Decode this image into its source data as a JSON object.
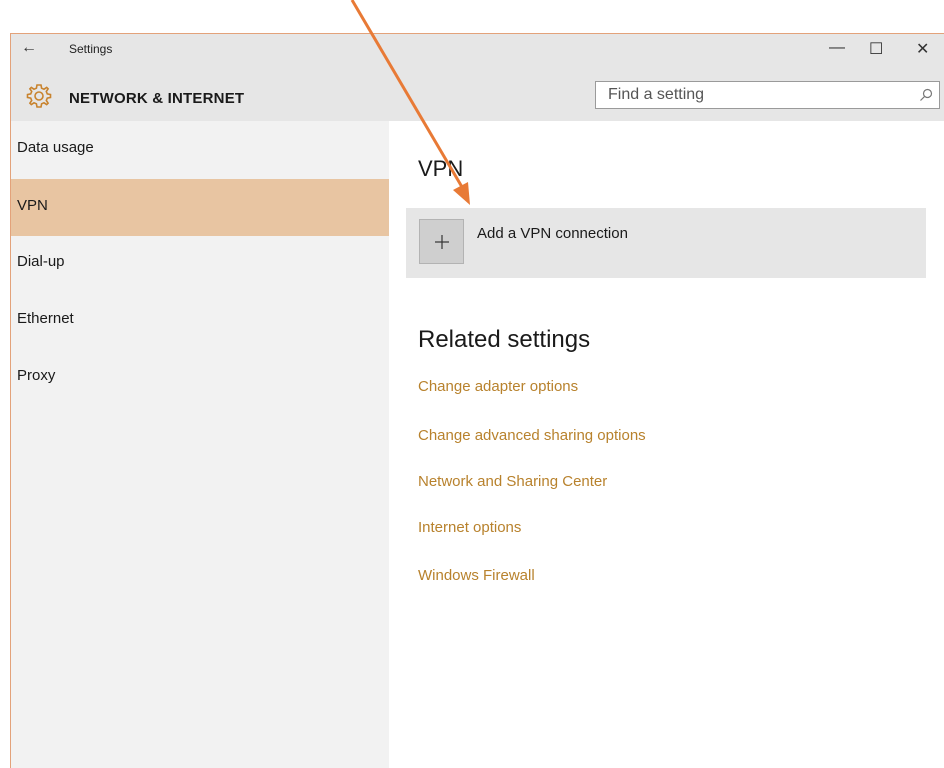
{
  "window": {
    "title": "Settings",
    "back_glyph": "←",
    "controls": {
      "minimize": "—",
      "maximize": "☐",
      "close": "✕"
    }
  },
  "header": {
    "icon": "gear-icon",
    "title": "NETWORK & INTERNET",
    "search": {
      "placeholder": "Find a setting",
      "value": "",
      "icon": "search-icon"
    }
  },
  "sidebar": {
    "items": [
      {
        "label": "Data usage",
        "selected": false
      },
      {
        "label": "VPN",
        "selected": true
      },
      {
        "label": "Dial-up",
        "selected": false
      },
      {
        "label": "Ethernet",
        "selected": false
      },
      {
        "label": "Proxy",
        "selected": false
      }
    ]
  },
  "main": {
    "title": "VPN",
    "add_vpn": {
      "label": "Add a VPN connection",
      "icon": "plus-icon"
    },
    "related": {
      "title": "Related settings",
      "links": [
        "Change adapter options",
        "Change advanced sharing options",
        "Network and Sharing Center",
        "Internet options",
        "Windows Firewall"
      ]
    }
  },
  "colors": {
    "accent": "#e8c5a2",
    "link": "#b8822d",
    "annotation_arrow": "#e87a36",
    "header_bg": "#e6e6e6",
    "sidebar_bg": "#f2f2f2"
  }
}
